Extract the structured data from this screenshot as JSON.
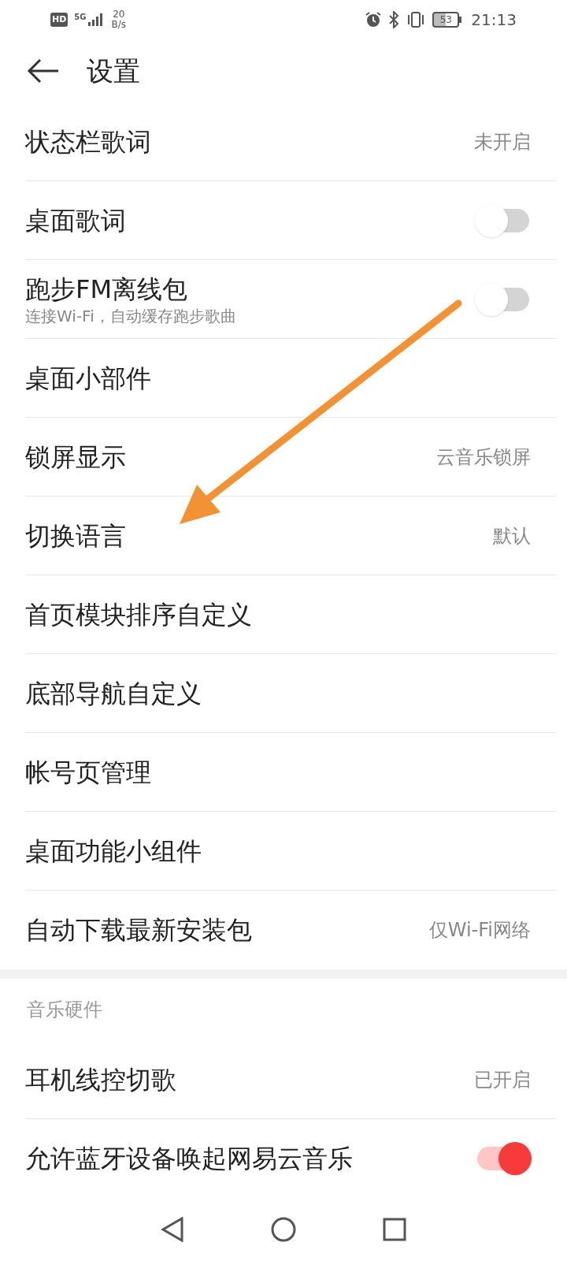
{
  "status_bar": {
    "hd": "HD",
    "network": "5G",
    "speed": "20",
    "speed_unit": "B/s",
    "battery": "53",
    "time": "21:13"
  },
  "header": {
    "title": "设置"
  },
  "sections": [
    {
      "items": [
        {
          "kind": "value",
          "label": "状态栏歌词",
          "value": "未开启"
        },
        {
          "kind": "toggle",
          "label": "桌面歌词",
          "on": false
        },
        {
          "kind": "toggle",
          "label": "跑步FM离线包",
          "subtitle": "连接Wi-Fi，自动缓存跑步歌曲",
          "on": false
        },
        {
          "kind": "plain",
          "label": "桌面小部件"
        },
        {
          "kind": "value",
          "label": "锁屏显示",
          "value": "云音乐锁屏"
        },
        {
          "kind": "value",
          "label": "切换语言",
          "value": "默认"
        },
        {
          "kind": "plain",
          "label": "首页模块排序自定义"
        },
        {
          "kind": "plain",
          "label": "底部导航自定义"
        },
        {
          "kind": "plain",
          "label": "帐号页管理"
        },
        {
          "kind": "plain",
          "label": "桌面功能小组件"
        },
        {
          "kind": "value",
          "label": "自动下载最新安装包",
          "value": "仅Wi-Fi网络"
        }
      ]
    },
    {
      "title": "音乐硬件",
      "items": [
        {
          "kind": "value",
          "label": "耳机线控切歌",
          "value": "已开启"
        },
        {
          "kind": "toggle",
          "label": "允许蓝牙设备唤起网易云音乐",
          "on": true
        }
      ]
    }
  ]
}
